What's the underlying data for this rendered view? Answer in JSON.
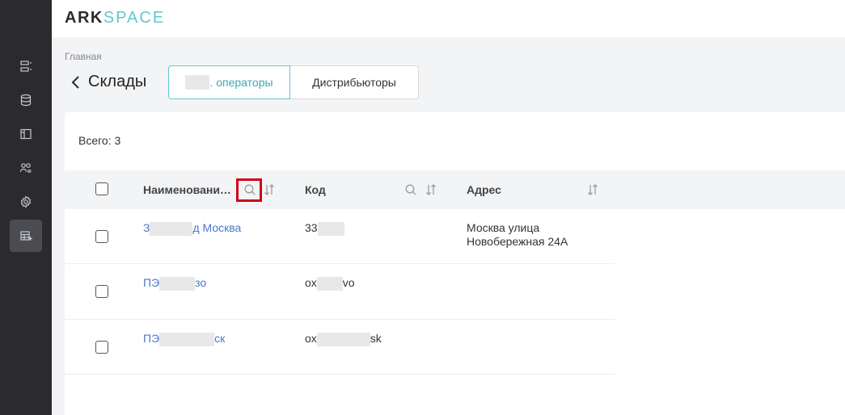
{
  "app": {
    "logo_primary": "ARK",
    "logo_secondary": "SPACE"
  },
  "sidebar": {
    "items": [
      {
        "icon": "list-icon"
      },
      {
        "icon": "database-icon"
      },
      {
        "icon": "layout-icon"
      },
      {
        "icon": "users-icon"
      },
      {
        "icon": "gear-icon"
      },
      {
        "icon": "warehouse-table-icon",
        "active": true
      }
    ]
  },
  "breadcrumb": "Главная",
  "page_title": "Склады",
  "tabs": [
    {
      "label": ". операторы",
      "active": true
    },
    {
      "label": "Дистрибьюторы",
      "active": false
    }
  ],
  "summary": {
    "total": "Всего: 3"
  },
  "table": {
    "columns": [
      "Наименовани…",
      "Код",
      "Адрес"
    ],
    "rows": [
      {
        "name_a": "З",
        "name_b": "д Москва",
        "code_a": "33",
        "code_b": "",
        "address_line1": "Москва улица",
        "address_line2": "Новобережная 24А"
      },
      {
        "name_a": "ПЭ",
        "name_b": "зо",
        "code_a": "ox",
        "code_b": "vo",
        "address_line1": "",
        "address_line2": ""
      },
      {
        "name_a": "ПЭ",
        "name_b": "ск",
        "code_a": "ox",
        "code_b": "sk",
        "address_line1": "",
        "address_line2": ""
      }
    ]
  },
  "colors": {
    "accent": "#5ec9cf",
    "link": "#4a78c9",
    "highlight": "#d0021b",
    "sidebar": "#2b2b2e"
  }
}
